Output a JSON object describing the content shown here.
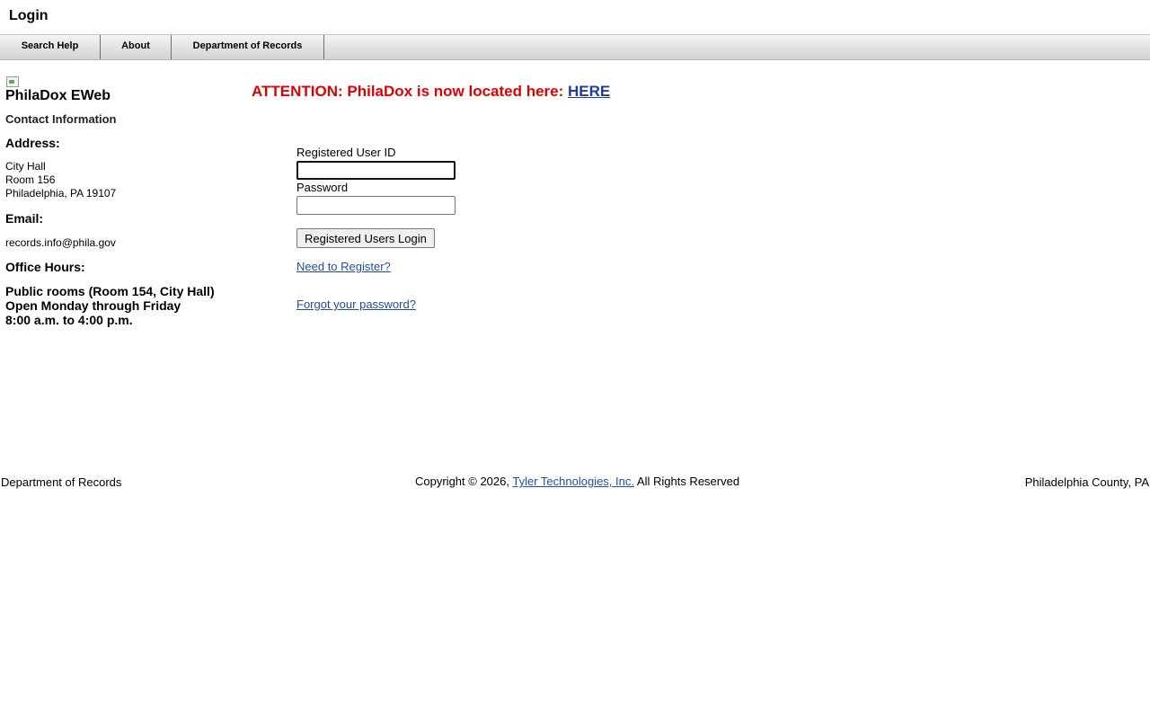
{
  "page_title": "Login",
  "menu": [
    {
      "label": "Search Help"
    },
    {
      "label": "About"
    },
    {
      "label": "Department of Records"
    }
  ],
  "sidebar": {
    "app_name": "PhilaDox EWeb",
    "contact_heading": "Contact Information",
    "address_label": "Address:",
    "address_lines": [
      "City Hall",
      "Room 156",
      "Philadelphia, PA 19107"
    ],
    "email_label": "Email:",
    "email": "records.info@phila.gov",
    "hours_label": "Office Hours:",
    "hours_lines": [
      "Public rooms (Room 154, City Hall)",
      "Open Monday through Friday",
      "8:00 a.m. to 4:00 p.m."
    ]
  },
  "notice": {
    "text": "ATTENTION: PhilaDox is now located here: ",
    "link_text": "HERE",
    "text_color": "#e00000",
    "link_color": "#1f3e9a"
  },
  "login": {
    "user_id_label": "Registered User ID",
    "user_id_value": "",
    "password_label": "Password",
    "password_value": "",
    "submit_label": "Registered Users Login",
    "register_link": "Need to Register?",
    "forgot_link": "Forgot your password?"
  },
  "footer": {
    "left": "Department of Records",
    "copyright_prefix": "Copyright © 2026,",
    "company_link": "Tyler Technologies, Inc.",
    "copyright_suffix": "All Rights Reserved",
    "right": "Philadelphia County, PA"
  }
}
